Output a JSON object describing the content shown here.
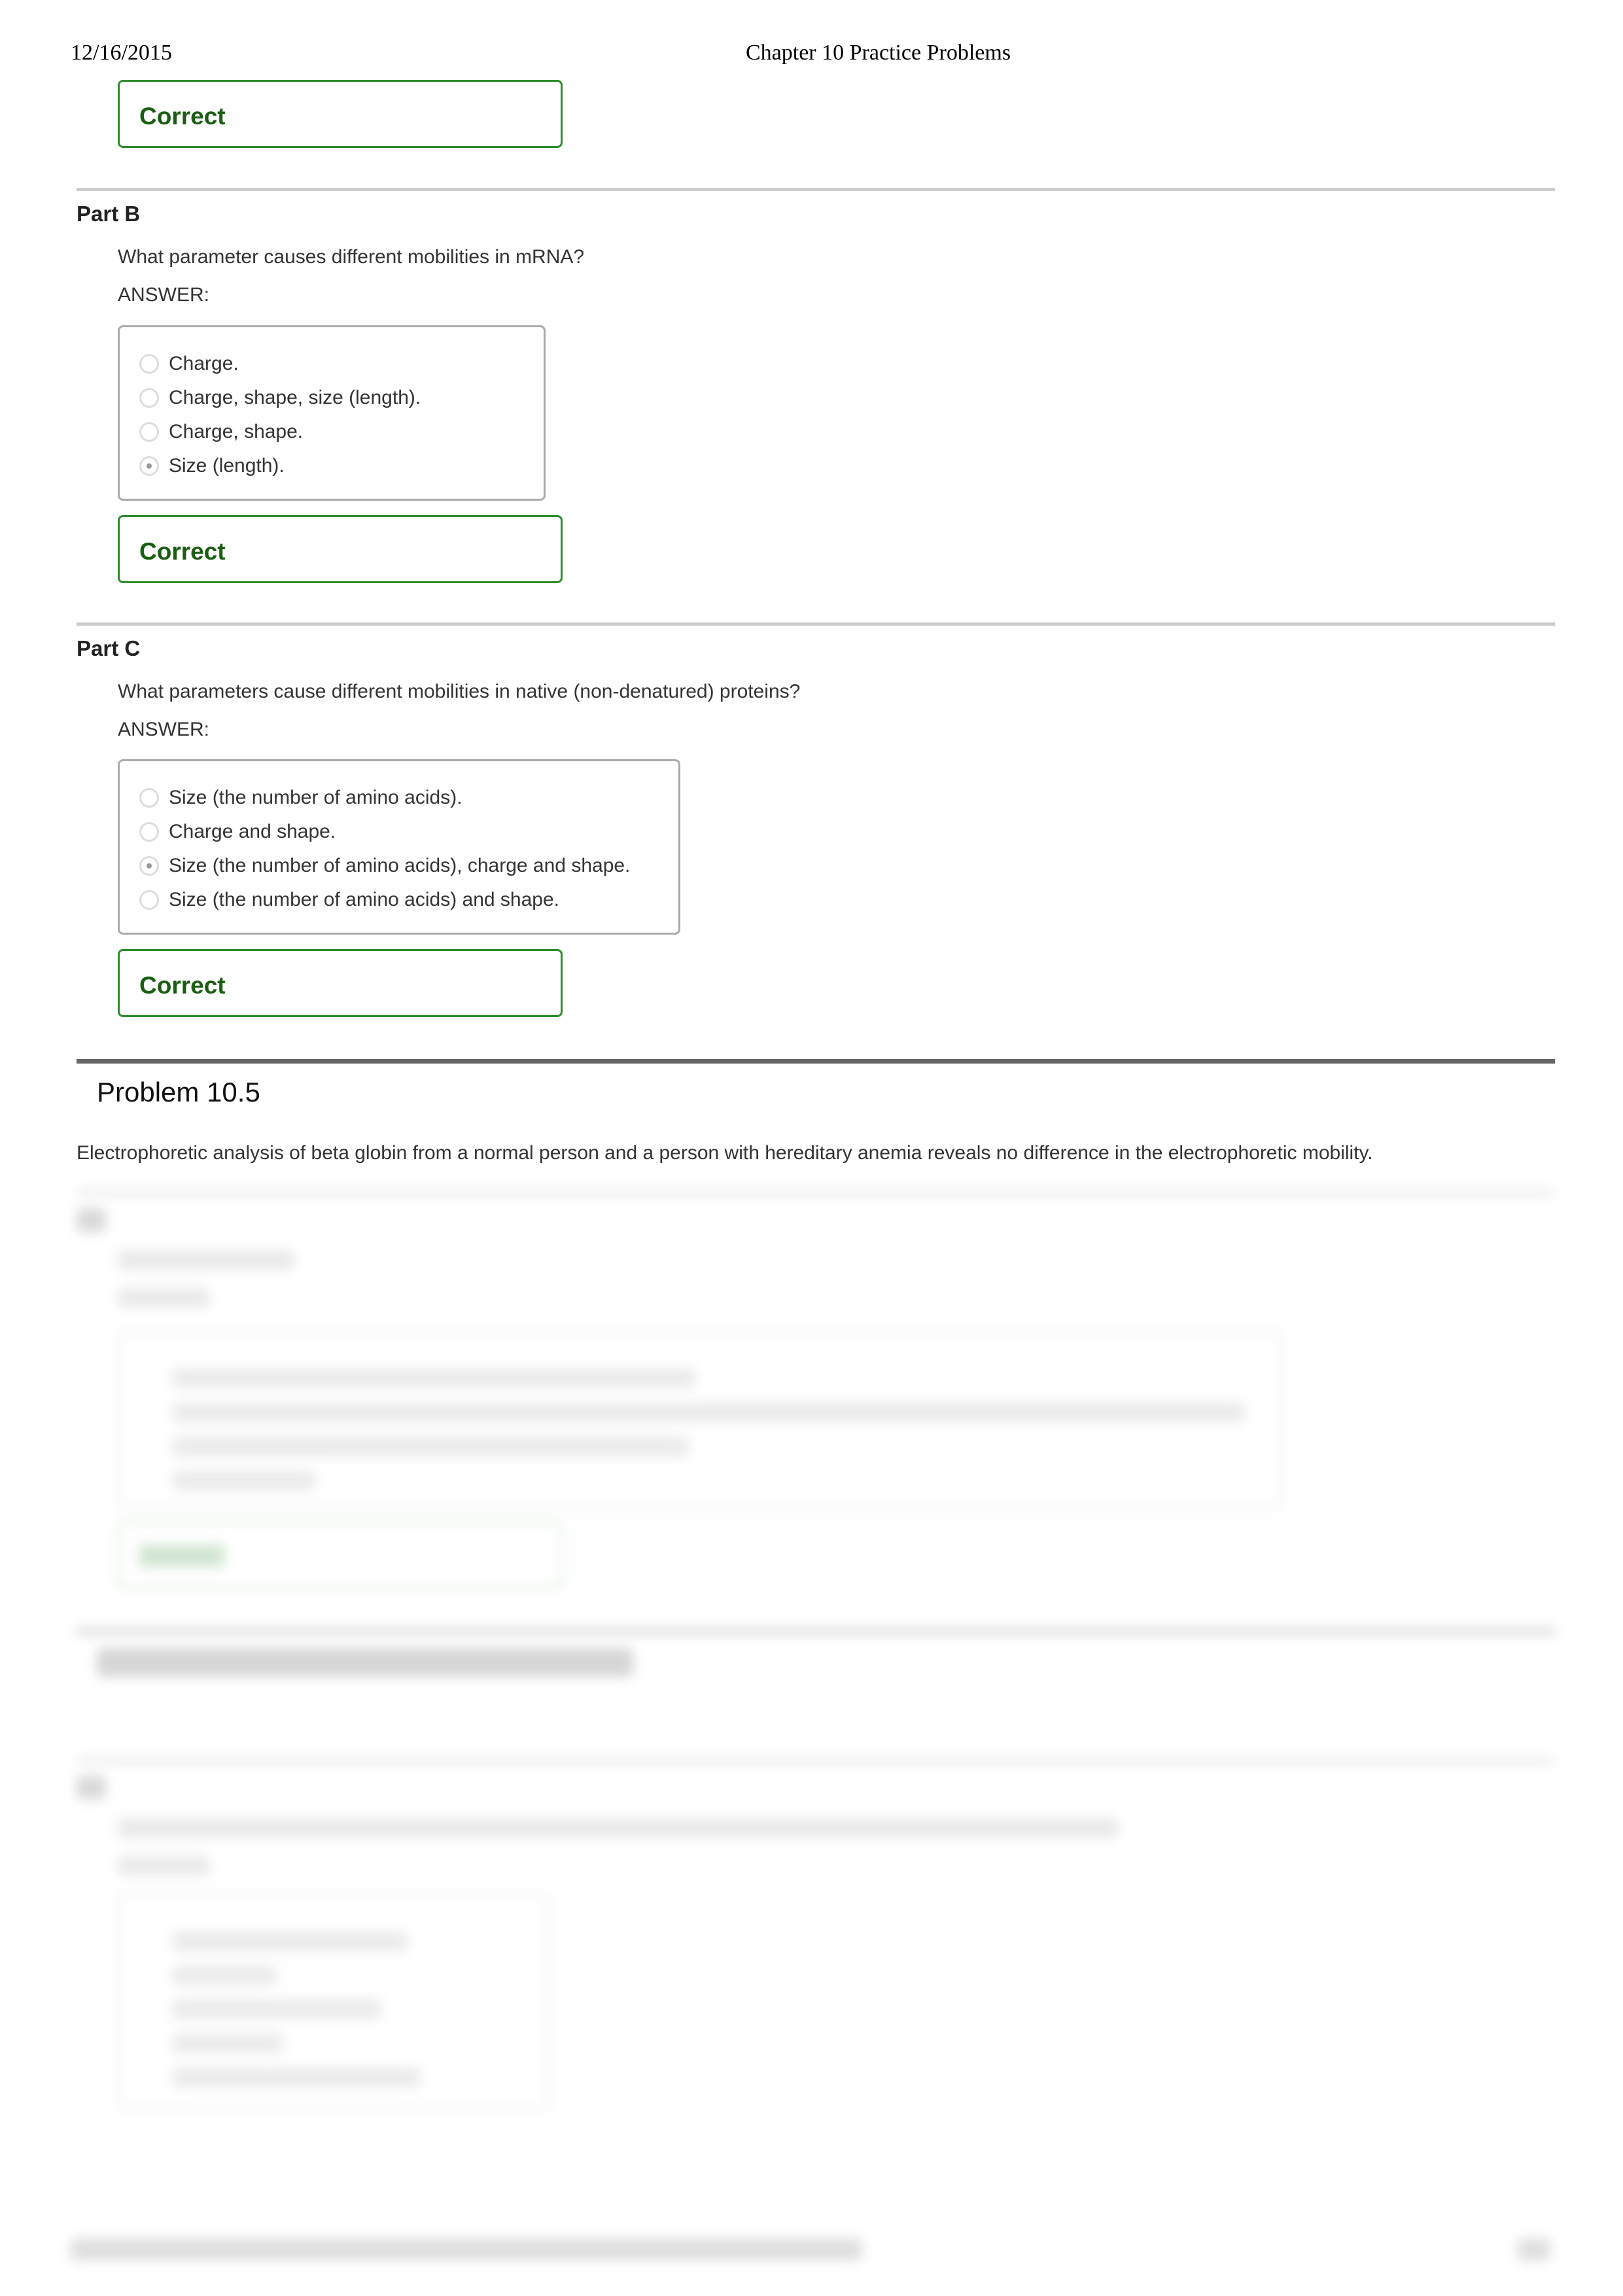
{
  "print_header": {
    "date": "12/16/2015",
    "title": "Chapter 10 Practice Problems"
  },
  "feedback_correct": "Correct",
  "part_b": {
    "title": "Part B",
    "question": "What parameter causes different mobilities in mRNA?",
    "answer_label": "ANSWER:",
    "choices": [
      {
        "label": "Charge.",
        "selected": false
      },
      {
        "label": "Charge, shape, size (length).",
        "selected": false
      },
      {
        "label": "Charge, shape.",
        "selected": false
      },
      {
        "label": "Size (length).",
        "selected": true
      }
    ],
    "feedback": "Correct"
  },
  "part_c": {
    "title": "Part C",
    "question": "What parameters cause different mobilities in native (non-denatured) proteins?",
    "answer_label": "ANSWER:",
    "choices": [
      {
        "label": "Size (the number of amino acids).",
        "selected": false
      },
      {
        "label": "Charge and shape.",
        "selected": false
      },
      {
        "label": "Size (the number of amino acids), charge and shape.",
        "selected": true
      },
      {
        "label": "Size (the number of amino acids) and shape.",
        "selected": false
      }
    ],
    "feedback": "Correct"
  },
  "problem_10_5": {
    "title": "Problem 10.5",
    "intro": "Electrophoretic analysis of beta globin from a normal person and a person with hereditary anemia reveals no difference in the electrophoretic mobility."
  }
}
